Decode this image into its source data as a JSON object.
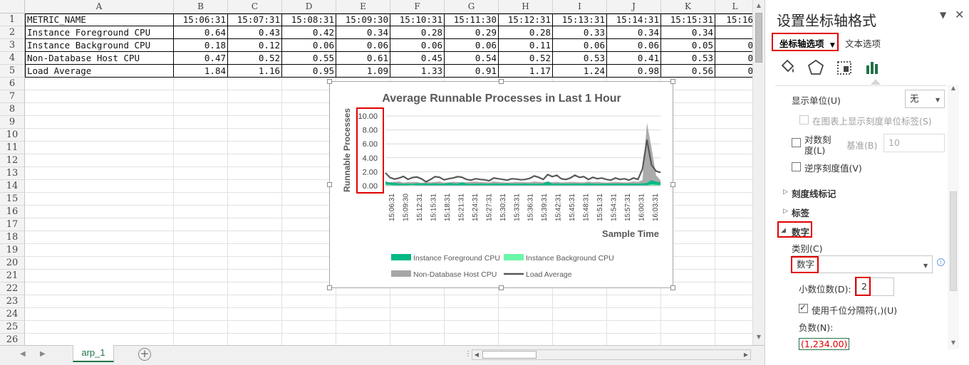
{
  "sheet": {
    "columns": [
      "A",
      "B",
      "C",
      "D",
      "E",
      "F",
      "G",
      "H",
      "I",
      "J",
      "K",
      "L"
    ],
    "rows": [
      "1",
      "2",
      "3",
      "4",
      "5",
      "6",
      "7",
      "8",
      "9",
      "10",
      "11",
      "12",
      "13",
      "14",
      "15",
      "16",
      "17",
      "18",
      "19",
      "20",
      "21",
      "22",
      "23",
      "24",
      "25",
      "26"
    ],
    "data": [
      [
        "METRIC_NAME",
        "15:06:31",
        "15:07:31",
        "15:08:31",
        "15:09:30",
        "15:10:31",
        "15:11:30",
        "15:12:31",
        "15:13:31",
        "15:14:31",
        "15:15:31",
        "15:16"
      ],
      [
        "Instance Foreground CPU",
        "0.64",
        "0.43",
        "0.42",
        "0.34",
        "0.28",
        "0.29",
        "0.28",
        "0.33",
        "0.34",
        "0.34",
        ""
      ],
      [
        "Instance Background CPU",
        "0.18",
        "0.12",
        "0.06",
        "0.06",
        "0.06",
        "0.06",
        "0.11",
        "0.06",
        "0.06",
        "0.05",
        "0"
      ],
      [
        "Non-Database Host CPU",
        "0.47",
        "0.52",
        "0.55",
        "0.61",
        "0.45",
        "0.54",
        "0.52",
        "0.53",
        "0.41",
        "0.53",
        "0"
      ],
      [
        "Load Average",
        "1.84",
        "1.16",
        "0.95",
        "1.09",
        "1.33",
        "0.91",
        "1.17",
        "1.24",
        "0.98",
        "0.56",
        "0"
      ]
    ],
    "tab_name": "arp_1"
  },
  "chart_data": {
    "type": "area",
    "title": "Average Runnable Processes in Last 1 Hour",
    "xlabel": "Sample Time",
    "ylabel": "Runnable Processes",
    "ylim": [
      0,
      10
    ],
    "y_ticks": [
      "10.00",
      "8.00",
      "6.00",
      "4.00",
      "2.00",
      "0.00"
    ],
    "x_tick_labels": [
      "15:06:31",
      "15:09:30",
      "15:12:31",
      "15:15:31",
      "15:18:31",
      "15:21:31",
      "15:24:31",
      "15:27:31",
      "15:30:31",
      "15:33:31",
      "15:36:31",
      "15:39:31",
      "15:42:31",
      "15:45:31",
      "15:48:31",
      "15:51:31",
      "15:54:31",
      "15:57:31",
      "16:00:31",
      "16:03:31"
    ],
    "grid": true,
    "legend_position": "bottom",
    "series": [
      {
        "name": "Instance Foreground CPU",
        "kind": "area",
        "color": "#00b884",
        "values": [
          0.64,
          0.43,
          0.42,
          0.34,
          0.28,
          0.29,
          0.28,
          0.33,
          0.34,
          0.34,
          0.3,
          0.35,
          0.28,
          0.3,
          0.4,
          0.35,
          0.3,
          0.5,
          0.3,
          0.28,
          0.3,
          0.32,
          0.3,
          0.28,
          0.33,
          0.3,
          0.3,
          0.35,
          0.28,
          0.3,
          0.3,
          0.32,
          0.3,
          0.28,
          0.3,
          0.32,
          0.6,
          0.3,
          0.34,
          0.3,
          0.28,
          0.3,
          0.32,
          0.3,
          0.3,
          0.35,
          0.3,
          0.28,
          0.3,
          0.32,
          0.3,
          0.3,
          0.33,
          0.3,
          0.3,
          0.32,
          0.3,
          0.35,
          0.4,
          0.8,
          0.6,
          0.5
        ]
      },
      {
        "name": "Instance Background CPU",
        "kind": "area",
        "color": "#6cf6a9",
        "values": [
          0.18,
          0.12,
          0.06,
          0.06,
          0.06,
          0.06,
          0.11,
          0.06,
          0.06,
          0.05,
          0.06,
          0.06,
          0.05,
          0.06,
          0.06,
          0.06,
          0.05,
          0.06,
          0.06,
          0.06,
          0.05,
          0.06,
          0.06,
          0.06,
          0.06,
          0.05,
          0.06,
          0.06,
          0.06,
          0.06,
          0.05,
          0.06,
          0.06,
          0.06,
          0.06,
          0.05,
          0.06,
          0.06,
          0.06,
          0.06,
          0.05,
          0.06,
          0.06,
          0.06,
          0.06,
          0.05,
          0.06,
          0.06,
          0.06,
          0.06,
          0.05,
          0.06,
          0.06,
          0.06,
          0.06,
          0.05,
          0.06,
          0.06,
          0.06,
          0.2,
          0.15,
          0.1
        ]
      },
      {
        "name": "Non-Database Host CPU",
        "kind": "area",
        "color": "#a6a6a6",
        "values": [
          0.47,
          0.52,
          0.55,
          0.61,
          0.45,
          0.54,
          0.52,
          0.53,
          0.41,
          0.53,
          0.5,
          0.55,
          0.6,
          0.45,
          0.5,
          0.55,
          0.52,
          0.48,
          0.5,
          0.55,
          0.6,
          0.52,
          0.5,
          0.48,
          0.6,
          0.55,
          0.5,
          0.45,
          0.5,
          0.55,
          0.52,
          0.5,
          0.48,
          0.6,
          0.55,
          0.5,
          0.6,
          0.5,
          0.55,
          0.48,
          0.5,
          0.55,
          0.52,
          0.5,
          0.48,
          0.6,
          0.5,
          0.55,
          0.5,
          0.45,
          0.5,
          0.55,
          0.5,
          0.48,
          0.5,
          0.6,
          0.55,
          0.8,
          9.0,
          5.5,
          1.5,
          0.8
        ]
      },
      {
        "name": "Load Average",
        "kind": "line",
        "color": "#595959",
        "values": [
          1.84,
          1.16,
          0.95,
          1.09,
          1.33,
          0.91,
          1.17,
          1.24,
          0.98,
          0.56,
          0.9,
          1.3,
          1.2,
          0.85,
          1.0,
          1.1,
          1.3,
          1.2,
          0.9,
          0.8,
          1.0,
          0.9,
          0.85,
          0.7,
          1.1,
          1.0,
          0.9,
          0.8,
          1.0,
          0.95,
          0.85,
          0.9,
          1.05,
          1.4,
          1.2,
          0.9,
          1.6,
          1.3,
          1.5,
          1.0,
          0.9,
          1.1,
          1.5,
          1.2,
          1.3,
          0.9,
          1.2,
          1.0,
          1.1,
          0.9,
          0.8,
          1.1,
          0.9,
          1.0,
          0.8,
          1.1,
          0.9,
          2.4,
          6.6,
          3.0,
          2.1,
          1.9
        ]
      }
    ]
  },
  "pane": {
    "title": "设置坐标轴格式",
    "tabs": {
      "axis_options": "坐标轴选项",
      "text_options": "文本选项"
    },
    "display_units_label": "显示单位(U)",
    "display_units_value": "无",
    "show_units_label": "在图表上显示刻度单位标签(S)",
    "log_scale_label_1": "对数刻",
    "log_scale_label_2": "度(L)",
    "base_label": "基准(B)",
    "base_value": "10",
    "reverse_label": "逆序刻度值(V)",
    "tick_marks_section": "刻度线标记",
    "labels_section": "标签",
    "number_section": "数字",
    "category_label": "类别(C)",
    "category_value": "数字",
    "decimals_label": "小数位数(D):",
    "decimals_value": "2",
    "thousands_label": "使用千位分隔符(,)(U)",
    "negative_label": "负数(N):",
    "negative_value": "(1,234.00)"
  }
}
